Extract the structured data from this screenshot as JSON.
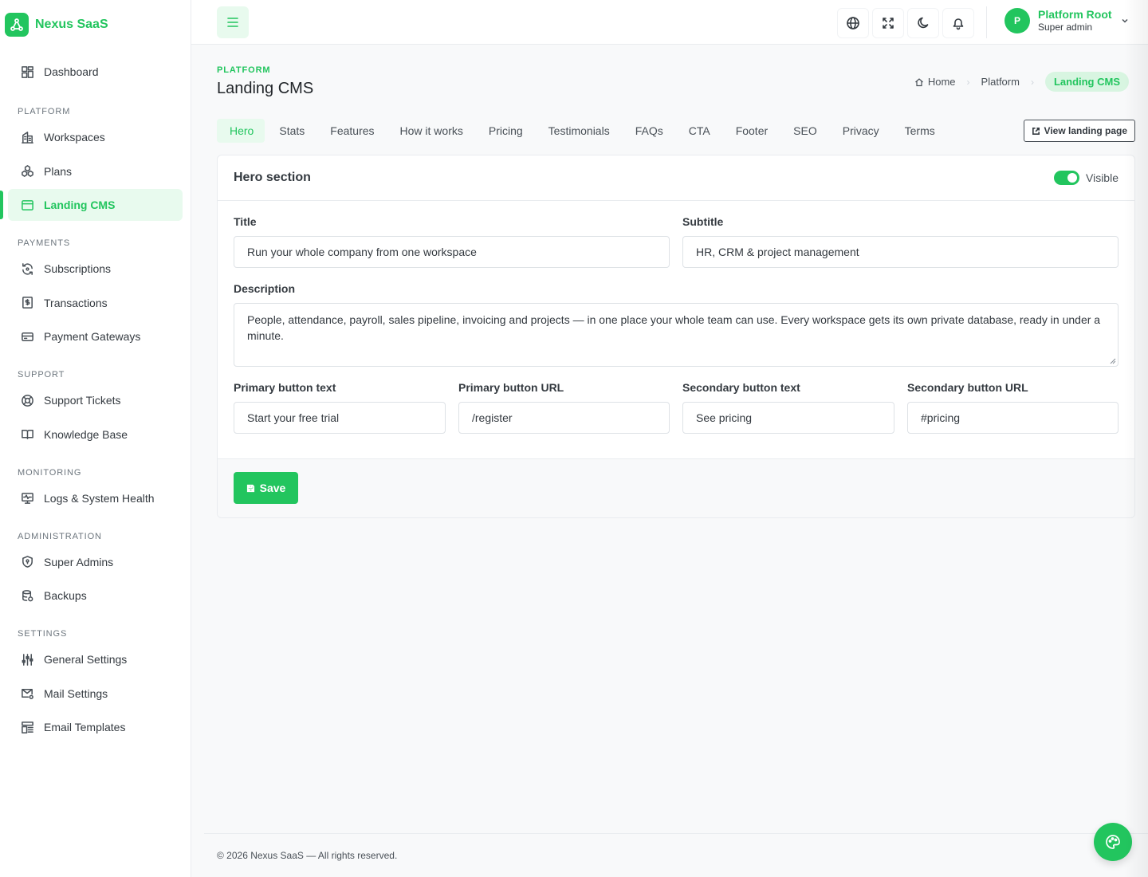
{
  "brand": {
    "name": "Nexus SaaS"
  },
  "sidebar": {
    "dashboard": "Dashboard",
    "sections": [
      {
        "heading": "PLATFORM",
        "items": [
          "Workspaces",
          "Plans",
          "Landing CMS"
        ]
      },
      {
        "heading": "PAYMENTS",
        "items": [
          "Subscriptions",
          "Transactions",
          "Payment Gateways"
        ]
      },
      {
        "heading": "SUPPORT",
        "items": [
          "Support Tickets",
          "Knowledge Base"
        ]
      },
      {
        "heading": "MONITORING",
        "items": [
          "Logs & System Health"
        ]
      },
      {
        "heading": "ADMINISTRATION",
        "items": [
          "Super Admins",
          "Backups"
        ]
      },
      {
        "heading": "SETTINGS",
        "items": [
          "General Settings",
          "Mail Settings",
          "Email Templates"
        ]
      }
    ]
  },
  "user": {
    "initial": "P",
    "name": "Platform Root",
    "role": "Super admin"
  },
  "page": {
    "eyebrow": "PLATFORM",
    "title": "Landing CMS",
    "breadcrumb": [
      "Home",
      "Platform",
      "Landing CMS"
    ],
    "view_button": "View landing page"
  },
  "tabs": [
    "Hero",
    "Stats",
    "Features",
    "How it works",
    "Pricing",
    "Testimonials",
    "FAQs",
    "CTA",
    "Footer",
    "SEO",
    "Privacy",
    "Terms"
  ],
  "hero": {
    "section_title": "Hero section",
    "visible_label": "Visible",
    "visible": true,
    "title_label": "Title",
    "title_value": "Run your whole company from one workspace",
    "subtitle_label": "Subtitle",
    "subtitle_value": "HR, CRM & project management",
    "description_label": "Description",
    "description_value": "People, attendance, payroll, sales pipeline, invoicing and projects — in one place your whole team can use. Every workspace gets its own private database, ready in under a minute.",
    "primary_text_label": "Primary button text",
    "primary_text_value": "Start your free trial",
    "primary_url_label": "Primary button URL",
    "primary_url_value": "/register",
    "secondary_text_label": "Secondary button text",
    "secondary_text_value": "See pricing",
    "secondary_url_label": "Secondary button URL",
    "secondary_url_value": "#pricing",
    "save_label": "Save"
  },
  "footer": {
    "text": "© 2026 Nexus SaaS — All rights reserved."
  },
  "colors": {
    "accent": "#22c55e",
    "accent_light": "#e8faee"
  }
}
